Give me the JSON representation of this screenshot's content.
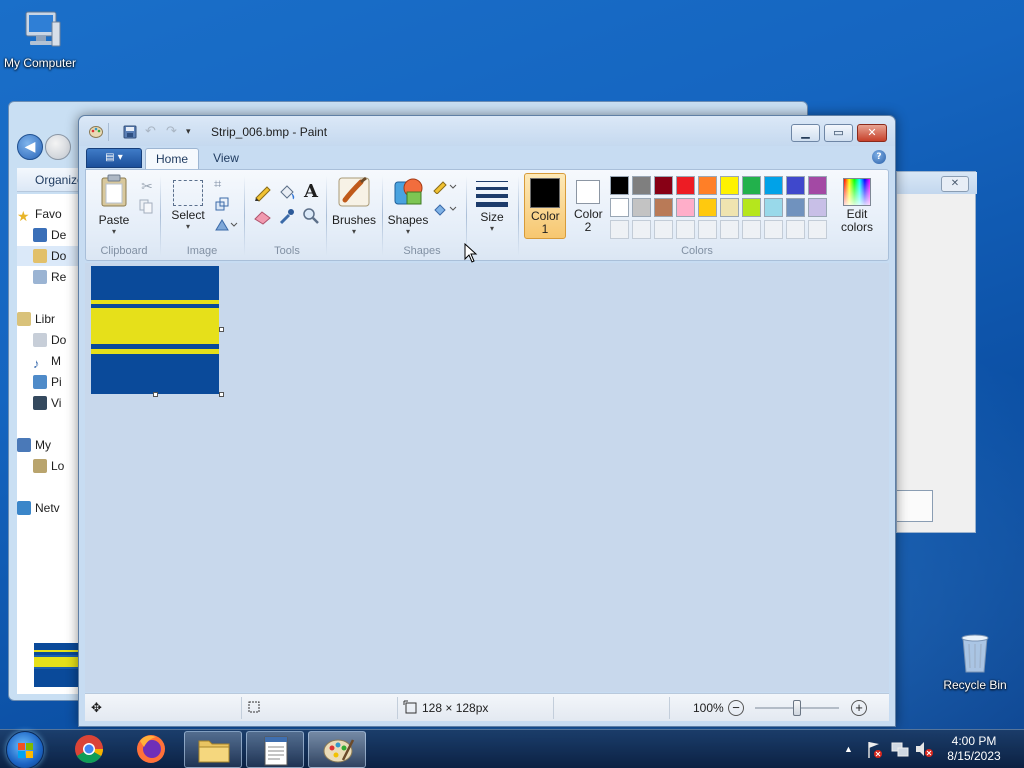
{
  "desktop": {
    "icons": [
      {
        "label": "My Computer"
      },
      {
        "label": "Recycle Bin"
      }
    ]
  },
  "explorer": {
    "organize_label": "Organize",
    "nav_items": [
      {
        "label": "Favorites",
        "icon": "star-icon",
        "color": "#e8b52a"
      },
      {
        "label": "Desktop",
        "icon": "desktop-icon",
        "color": "#3a6fb8"
      },
      {
        "label": "Downloads",
        "icon": "downloads-icon",
        "color": "#e2c06a"
      },
      {
        "label": "Recent Places",
        "icon": "recent-places-icon",
        "color": "#9bb4d3"
      },
      {
        "label": "Libraries",
        "icon": "libraries-icon",
        "color": "#d9c27a"
      },
      {
        "label": "Documents",
        "icon": "documents-icon",
        "color": "#c7ced8"
      },
      {
        "label": "Music",
        "icon": "music-icon",
        "color": "#3f6fb0"
      },
      {
        "label": "Pictures",
        "icon": "pictures-icon",
        "color": "#4f8bc9"
      },
      {
        "label": "Videos",
        "icon": "videos-icon",
        "color": "#34495e"
      },
      {
        "label": "My Computer",
        "icon": "computer-icon",
        "color": "#4a79b8"
      },
      {
        "label": "Local Disk",
        "icon": "local-disk-icon",
        "color": "#b9a46d"
      },
      {
        "label": "Network",
        "icon": "network-icon",
        "color": "#3b86c9"
      }
    ],
    "nav_visible": [
      "Favo",
      "De",
      "Do",
      "Re",
      "Libr",
      "Do",
      "M",
      "Pi",
      "Vi",
      "My",
      "Lo",
      "Netv"
    ]
  },
  "dialog": {
    "close_glyph": "✕"
  },
  "paint": {
    "title": "Strip_006.bmp - Paint",
    "window_buttons": {
      "minimize": "▁",
      "maximize": "▭",
      "close": "✕"
    },
    "tabs": [
      {
        "label": "Home",
        "active": true
      },
      {
        "label": "View",
        "active": false
      }
    ],
    "help_glyph": "?",
    "ribbon": {
      "groups": {
        "clipboard": "Clipboard",
        "image": "Image",
        "tools": "Tools",
        "shapes": "Shapes",
        "colors": "Colors"
      },
      "buttons": {
        "paste": "Paste",
        "select": "Select",
        "brushes": "Brushes",
        "shapes": "Shapes",
        "size": "Size",
        "color1": "Color 1",
        "color2": "Color 2",
        "edit_colors": "Edit colors"
      },
      "color1_value": "#000000",
      "color2_value": "#ffffff",
      "palette_row1": [
        "#000000",
        "#7f7f7f",
        "#880015",
        "#ed1c24",
        "#ff7f27",
        "#fff200",
        "#22b14c",
        "#00a2e8",
        "#3f48cc",
        "#a349a4"
      ],
      "palette_row2": [
        "#ffffff",
        "#c3c3c3",
        "#b97a57",
        "#ffaec9",
        "#ffc90e",
        "#efe4b0",
        "#b5e61d",
        "#99d9ea",
        "#7092be",
        "#c8bfe7"
      ]
    },
    "canvas": {
      "bands": [
        {
          "color": "#0a4a9a",
          "label": "blue-top"
        },
        {
          "color": "#e6e01a",
          "label": "yellow-thin"
        },
        {
          "color": "#0a4a9a",
          "label": "blue-gap"
        },
        {
          "color": "#e6e01a",
          "label": "yellow-wide"
        },
        {
          "color": "#0a4a9a",
          "label": "blue-gap-2"
        },
        {
          "color": "#e6e01a",
          "label": "yellow-thin-2"
        },
        {
          "color": "#0a4a9a",
          "label": "blue-bottom"
        }
      ]
    },
    "status": {
      "dimensions": "128 × 128px",
      "zoom": "100%",
      "zoom_out": "−",
      "zoom_in": "+"
    }
  },
  "taskbar": {
    "apps": [
      {
        "name": "chrome"
      },
      {
        "name": "firefox"
      },
      {
        "name": "explorer"
      },
      {
        "name": "notepad"
      },
      {
        "name": "paint"
      }
    ],
    "time": "4:00 PM",
    "date": "8/15/2023"
  }
}
